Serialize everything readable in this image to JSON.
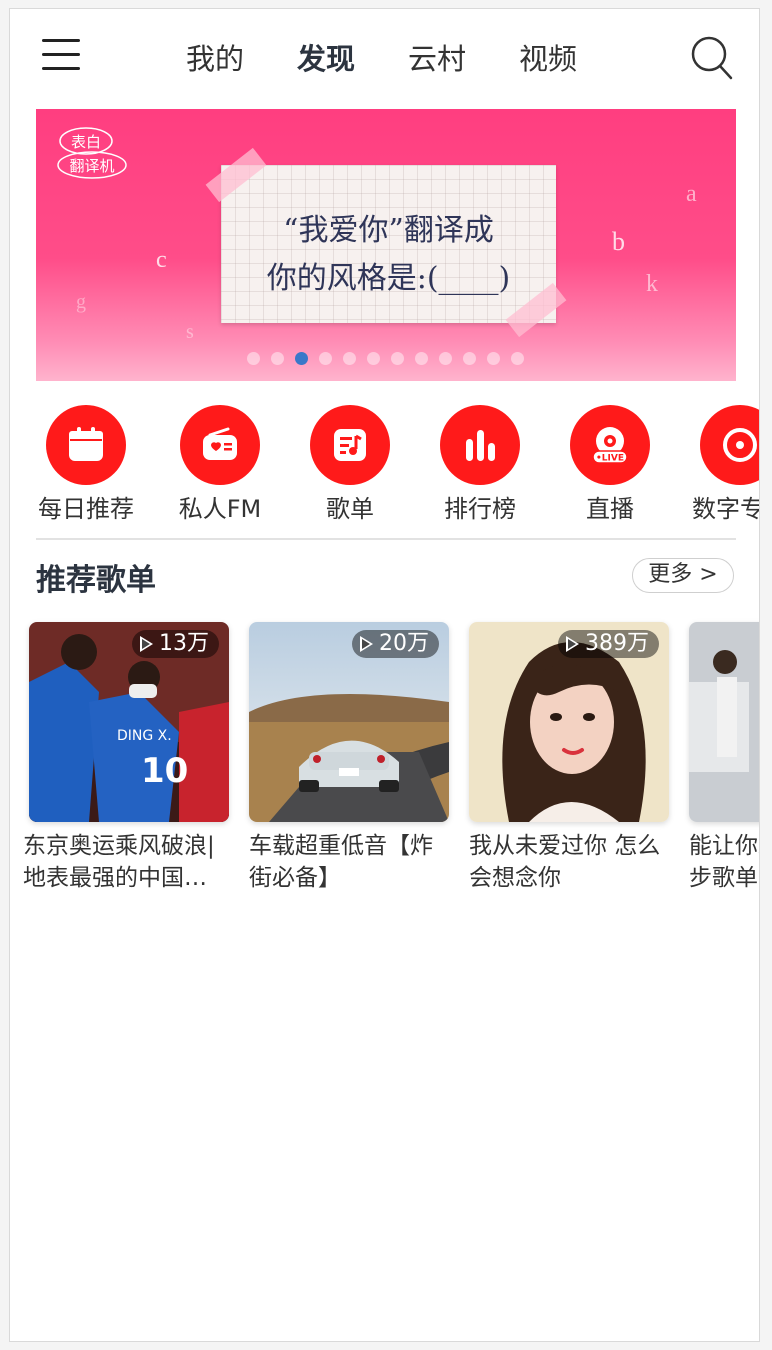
{
  "header": {
    "tabs": [
      {
        "label": "我的"
      },
      {
        "label": "发现"
      },
      {
        "label": "云村"
      },
      {
        "label": "视频"
      }
    ],
    "active_tab": "发现"
  },
  "banner": {
    "logo_text": "表白翻译机",
    "note_line1": "“我爱你”翻译成",
    "note_line2": "你的风格是:(____)",
    "letters": [
      "c",
      "g",
      "s",
      "b",
      "a",
      "k"
    ],
    "dot_count": 12,
    "active_dot": 2
  },
  "quick_icons": [
    {
      "label": "每日推荐",
      "icon": "calendar-icon"
    },
    {
      "label": "私人FM",
      "icon": "radio-icon"
    },
    {
      "label": "歌单",
      "icon": "playlist-icon"
    },
    {
      "label": "排行榜",
      "icon": "chart-icon"
    },
    {
      "label": "直播",
      "icon": "live-icon"
    },
    {
      "label": "数字专辑",
      "icon": "album-icon"
    }
  ],
  "recommended": {
    "title": "推荐歌单",
    "more_label": "更多 >",
    "playlists": [
      {
        "play_count": "13万",
        "title": "东京奥运乘风破浪|地表最强的中国女排"
      },
      {
        "play_count": "20万",
        "title": "车载超重低音【炸街必备】"
      },
      {
        "play_count": "389万",
        "title": "我从未爱过你 怎么会想念你"
      },
      {
        "play_count": "",
        "title": "能让你跑起来的跑步歌单"
      }
    ]
  },
  "colors": {
    "accent": "#ff1a1a",
    "banner_pink": "#ff3e80",
    "dot_active": "#3a78c9"
  }
}
